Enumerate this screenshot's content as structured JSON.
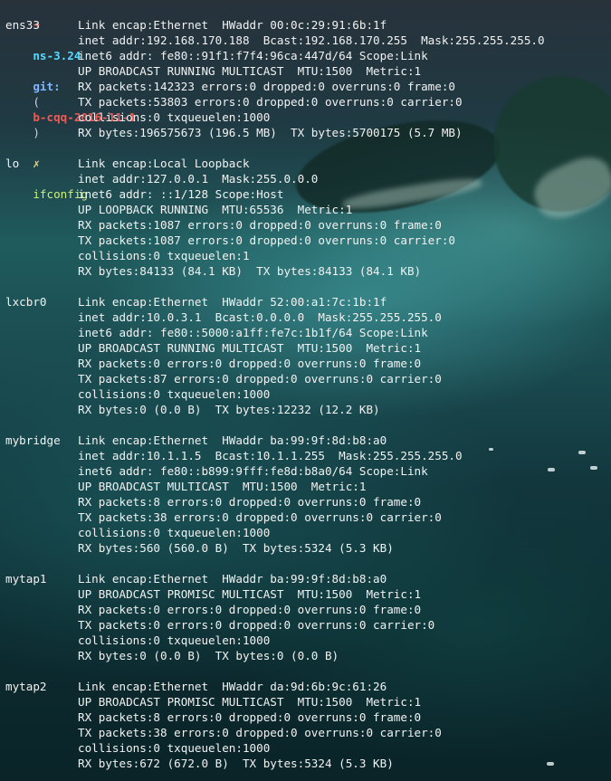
{
  "prompt": {
    "arrow": "➜",
    "directory": "ns-3.24",
    "git_label": "git:",
    "branch_open": "(",
    "branch": "b-cqq-2016-11-1",
    "branch_close": ")",
    "cross": "✗",
    "command": "ifconfig"
  },
  "interfaces": [
    {
      "name": "ens33",
      "lines": [
        "Link encap:Ethernet  HWaddr 00:0c:29:91:6b:1f",
        "inet addr:192.168.170.188  Bcast:192.168.170.255  Mask:255.255.255.0",
        "inet6 addr: fe80::91f1:f7f4:96ca:447d/64 Scope:Link",
        "UP BROADCAST RUNNING MULTICAST  MTU:1500  Metric:1",
        "RX packets:142323 errors:0 dropped:0 overruns:0 frame:0",
        "TX packets:53803 errors:0 dropped:0 overruns:0 carrier:0",
        "collisions:0 txqueuelen:1000",
        "RX bytes:196575673 (196.5 MB)  TX bytes:5700175 (5.7 MB)"
      ]
    },
    {
      "name": "lo",
      "lines": [
        "Link encap:Local Loopback",
        "inet addr:127.0.0.1  Mask:255.0.0.0",
        "inet6 addr: ::1/128 Scope:Host",
        "UP LOOPBACK RUNNING  MTU:65536  Metric:1",
        "RX packets:1087 errors:0 dropped:0 overruns:0 frame:0",
        "TX packets:1087 errors:0 dropped:0 overruns:0 carrier:0",
        "collisions:0 txqueuelen:1",
        "RX bytes:84133 (84.1 KB)  TX bytes:84133 (84.1 KB)"
      ]
    },
    {
      "name": "lxcbr0",
      "lines": [
        "Link encap:Ethernet  HWaddr 52:00:a1:7c:1b:1f",
        "inet addr:10.0.3.1  Bcast:0.0.0.0  Mask:255.255.255.0",
        "inet6 addr: fe80::5000:a1ff:fe7c:1b1f/64 Scope:Link",
        "UP BROADCAST RUNNING MULTICAST  MTU:1500  Metric:1",
        "RX packets:0 errors:0 dropped:0 overruns:0 frame:0",
        "TX packets:87 errors:0 dropped:0 overruns:0 carrier:0",
        "collisions:0 txqueuelen:1000",
        "RX bytes:0 (0.0 B)  TX bytes:12232 (12.2 KB)"
      ]
    },
    {
      "name": "mybridge",
      "lines": [
        "Link encap:Ethernet  HWaddr ba:99:9f:8d:b8:a0",
        "inet addr:10.1.1.5  Bcast:10.1.1.255  Mask:255.255.255.0",
        "inet6 addr: fe80::b899:9fff:fe8d:b8a0/64 Scope:Link",
        "UP BROADCAST MULTICAST  MTU:1500  Metric:1",
        "RX packets:8 errors:0 dropped:0 overruns:0 frame:0",
        "TX packets:38 errors:0 dropped:0 overruns:0 carrier:0",
        "collisions:0 txqueuelen:1000",
        "RX bytes:560 (560.0 B)  TX bytes:5324 (5.3 KB)"
      ]
    },
    {
      "name": "mytap1",
      "lines": [
        "Link encap:Ethernet  HWaddr ba:99:9f:8d:b8:a0",
        "UP BROADCAST PROMISC MULTICAST  MTU:1500  Metric:1",
        "RX packets:0 errors:0 dropped:0 overruns:0 frame:0",
        "TX packets:0 errors:0 dropped:0 overruns:0 carrier:0",
        "collisions:0 txqueuelen:1000",
        "RX bytes:0 (0.0 B)  TX bytes:0 (0.0 B)"
      ]
    },
    {
      "name": "mytap2",
      "lines": [
        "Link encap:Ethernet  HWaddr da:9d:6b:9c:61:26",
        "UP BROADCAST PROMISC MULTICAST  MTU:1500  Metric:1",
        "RX packets:8 errors:0 dropped:0 overruns:0 frame:0",
        "TX packets:38 errors:0 dropped:0 overruns:0 carrier:0",
        "collisions:0 txqueuelen:1000",
        "RX bytes:672 (672.0 B)  TX bytes:5324 (5.3 KB)"
      ]
    }
  ]
}
